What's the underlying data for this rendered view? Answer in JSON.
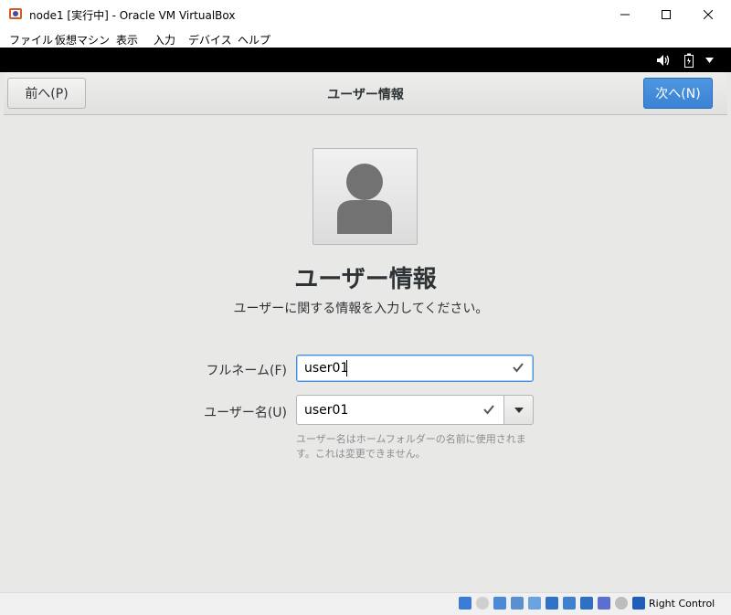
{
  "window": {
    "title": "node1 [実行中] - Oracle VM VirtualBox",
    "menus": [
      "ファイル",
      "仮想マシン",
      "表示",
      "入力",
      "デバイス",
      "ヘルプ"
    ]
  },
  "header": {
    "back_label": "前へ(P)",
    "title": "ユーザー情報",
    "next_label": "次へ(N)",
    "next_color": "#3a82d4"
  },
  "main": {
    "title": "ユーザー情報",
    "subtitle": "ユーザーに関する情報を入力してください。",
    "fullname_label": "フルネーム(F)",
    "fullname_value": "user01",
    "username_label": "ユーザー名(U)",
    "username_value": "user01",
    "hint": "ユーザー名はホームフォルダーの名前に使用されます。これは変更できません。"
  },
  "statusbar": {
    "host_key": "Right Control",
    "icons": [
      "cd-icon",
      "network-icon",
      "usb-icon",
      "shared-folder-icon",
      "pen-icon",
      "display-icon",
      "recording-icon",
      "audio-icon",
      "vbox-icon",
      "mouse-icon",
      "download-icon"
    ]
  }
}
